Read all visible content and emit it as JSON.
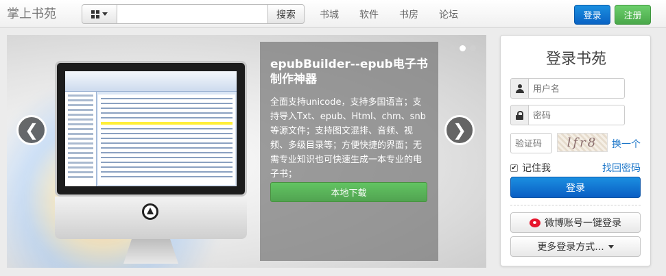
{
  "header": {
    "brand": "掌上书苑",
    "search": {
      "value": "",
      "placeholder": "",
      "button_label": "搜索",
      "category_icon": "grid-icon"
    },
    "nav": [
      "书城",
      "软件",
      "书房",
      "论坛"
    ],
    "login_label": "登录",
    "register_label": "注册"
  },
  "carousel": {
    "slide_title": "epubBuilder--epub电子书制作神器",
    "slide_description": "全面支持unicode，支持多国语言；支持导入Txt、epub、Html、chm、snb等源文件；支持图文混排、音频、视频、多级目录等；方便快捷的界面；无需专业知识也可快速生成一本专业的电子书；",
    "download_label": "本地下载",
    "prev_label": "❮",
    "next_label": "❯",
    "active_slide": 2,
    "slide_count": 3
  },
  "login": {
    "title": "登录书苑",
    "username_placeholder": "用户名",
    "password_placeholder": "密码",
    "captcha_placeholder": "验证码",
    "captcha_text": "lfr8",
    "refresh_label": "换一个",
    "remember_label": "记住我",
    "remember_checked": true,
    "forgot_label": "找回密码",
    "submit_label": "登录",
    "weibo_label": "微博账号一键登录",
    "more_label": "更多登录方式..."
  },
  "colors": {
    "primary": "#0a63c4",
    "success": "#4aa84a",
    "link": "#1a75c8",
    "weibo": "#e6162d"
  }
}
